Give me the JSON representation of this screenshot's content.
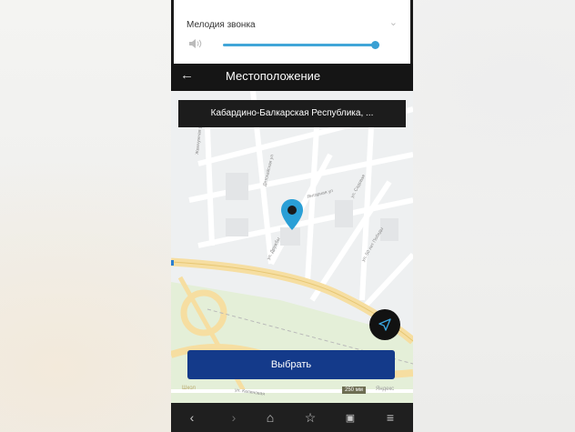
{
  "ringtone": {
    "label": "Мелодия звонка",
    "volume_level": 0.97
  },
  "appbar": {
    "title": "Местоположение"
  },
  "address": {
    "value": "Кабардино-Балкарская Республика, ..."
  },
  "map": {
    "streets": [
      "Жемчужная ул",
      "Детскайская ул",
      "Янтарная ул",
      "ул. Садовая",
      "ул. Дружбы",
      "ул. 50 лет Победы",
      "ул. Калиновая"
    ],
    "scale": "250 мм",
    "credit": "Яндекс",
    "logo": "Школ"
  },
  "select_button": {
    "label": "Выбрать"
  },
  "colors": {
    "accent_blue": "#143a8a",
    "slider": "#41a6d8",
    "pin": "#2a9fd6"
  },
  "navbar": {
    "icons": [
      "back-icon",
      "forward-icon",
      "home-icon",
      "star-icon",
      "tabs-icon",
      "menu-icon"
    ]
  }
}
